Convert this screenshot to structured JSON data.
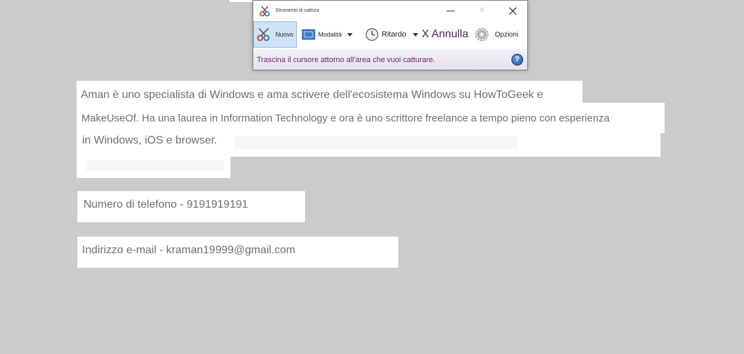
{
  "snipping_tool": {
    "title": "Strumento di cattura",
    "toolbar": {
      "new_label": "Nuovo",
      "mode_label": "Modalità",
      "delay_label": "Ritardo",
      "cancel_label": "X Annulla",
      "options_label": "Opzioni"
    },
    "hint": "Trascina il cursore attorno all'area che vuoi catturare.",
    "help_glyph": "?"
  },
  "background": {
    "paragraph_lines": [
      "Aman è uno specialista di Windows e ama scrivere dell'ecosistema Windows su HowToGeek e",
      "MakeUseOf. Ha una laurea in Information Technology e ora è uno scrittore freelance a tempo pieno con esperienza",
      "in Windows, iOS e browser."
    ],
    "phone": "Numero di telefono - 9191919191",
    "email": "Indirizzo e-mail - kraman19999@gmail.com"
  },
  "colors": {
    "desktop": "#cbcbcb",
    "text": "#6e6e6e",
    "hint_text": "#6b1a7a",
    "selected_button": "#cfe3f6"
  }
}
